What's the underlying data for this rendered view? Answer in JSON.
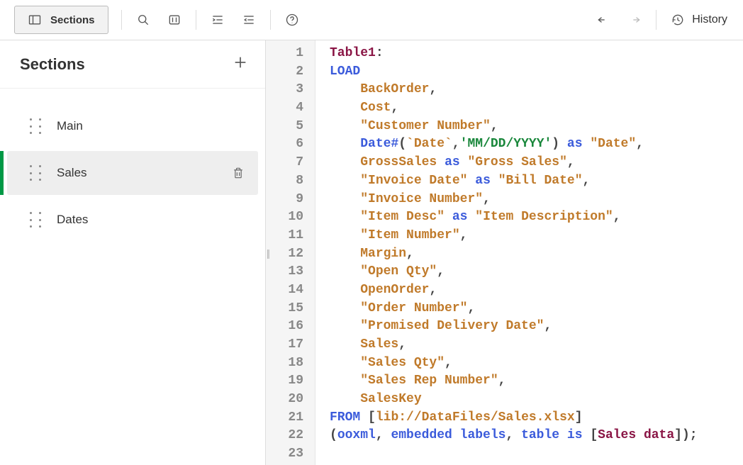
{
  "toolbar": {
    "sections_toggle_label": "Sections",
    "history_label": "History"
  },
  "sidebar": {
    "title": "Sections",
    "items": [
      {
        "label": "Main",
        "active": false
      },
      {
        "label": "Sales",
        "active": true
      },
      {
        "label": "Dates",
        "active": false
      }
    ]
  },
  "editor": {
    "line_count": 23,
    "script": {
      "table_name": "Table1",
      "source_path": "lib://DataFiles/Sales.xlsx",
      "format": "ooxml",
      "header_mode": "embedded labels",
      "sheet": "Sales data",
      "date_format": "MM/DD/YYYY",
      "fields": [
        {
          "expr": "BackOrder"
        },
        {
          "expr": "Cost"
        },
        {
          "expr": "\"Customer Number\""
        },
        {
          "expr": "Date#(`Date`,'MM/DD/YYYY')",
          "as": "\"Date\""
        },
        {
          "expr": "GrossSales",
          "as": "\"Gross Sales\""
        },
        {
          "expr": "\"Invoice Date\"",
          "as": "\"Bill Date\""
        },
        {
          "expr": "\"Invoice Number\""
        },
        {
          "expr": "\"Item Desc\"",
          "as": "\"Item Description\""
        },
        {
          "expr": "\"Item Number\""
        },
        {
          "expr": "Margin"
        },
        {
          "expr": "\"Open Qty\""
        },
        {
          "expr": "OpenOrder"
        },
        {
          "expr": "\"Order Number\""
        },
        {
          "expr": "\"Promised Delivery Date\""
        },
        {
          "expr": "Sales"
        },
        {
          "expr": "\"Sales Qty\""
        },
        {
          "expr": "\"Sales Rep Number\""
        },
        {
          "expr": "SalesKey"
        }
      ]
    }
  },
  "tokens": {
    "LOAD": "LOAD",
    "FROM": "FROM",
    "as": "as",
    "is": "is",
    "table": "table",
    "Date#": "Date#",
    "ooxml": "ooxml",
    "embedded_labels": "embedded labels"
  }
}
